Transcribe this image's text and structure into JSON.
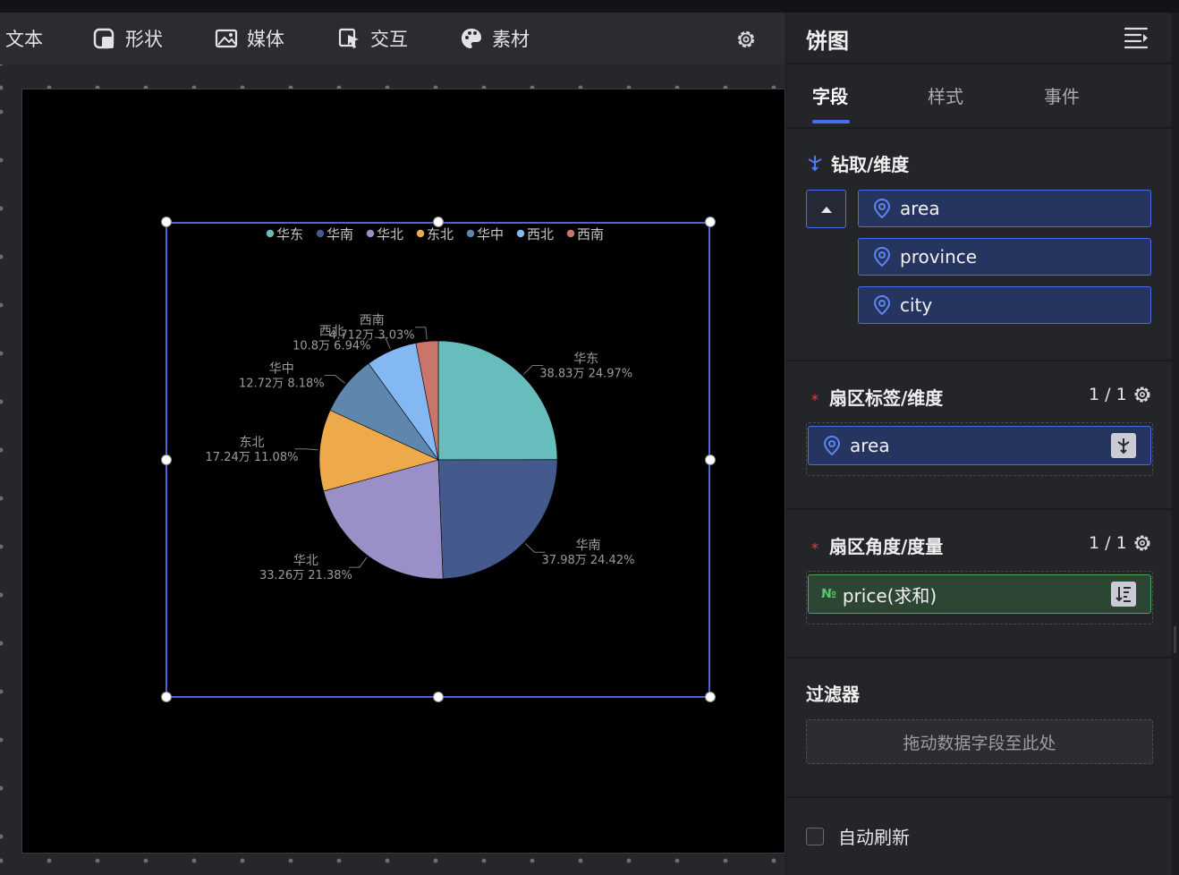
{
  "toolbar": {
    "items": [
      {
        "label": "文本",
        "icon": "text-icon"
      },
      {
        "label": "形状",
        "icon": "shape-icon"
      },
      {
        "label": "媒体",
        "icon": "image-icon"
      },
      {
        "label": "交互",
        "icon": "pointer-icon"
      },
      {
        "label": "素材",
        "icon": "palette-icon"
      }
    ],
    "settings_icon": "gear-icon"
  },
  "panel": {
    "title": "饼图",
    "menu_icon": "menu-collapse-icon",
    "tabs": [
      {
        "label": "字段",
        "active": true
      },
      {
        "label": "样式",
        "active": false
      },
      {
        "label": "事件",
        "active": false
      }
    ],
    "drill": {
      "label": "钻取/维度",
      "fields": [
        "area",
        "province",
        "city"
      ]
    },
    "sector_label": {
      "label": "扇区标签/维度",
      "count": "1 / 1",
      "field": "area"
    },
    "sector_angle": {
      "label": "扇区角度/度量",
      "count": "1 / 1",
      "field": "price(求和)",
      "type_badge": "№"
    },
    "filter": {
      "label": "过滤器",
      "placeholder": "拖动数据字段至此处"
    },
    "auto_refresh": {
      "label": "自动刷新",
      "checked": false
    }
  },
  "chart_data": {
    "type": "pie",
    "categories": [
      "华东",
      "华南",
      "华北",
      "东北",
      "华中",
      "西北",
      "西南"
    ],
    "values": [
      38.83,
      37.98,
      33.26,
      17.24,
      12.72,
      10.8,
      4.712
    ],
    "value_labels": [
      "38.83万",
      "37.98万",
      "33.26万",
      "17.24万",
      "12.72万",
      "10.8万",
      "4.712万"
    ],
    "percent_labels": [
      "24.97%",
      "24.42%",
      "21.38%",
      "11.08%",
      "8.18%",
      "6.94%",
      "3.03%"
    ],
    "colors": [
      "#67bcbc",
      "#455a8c",
      "#9a8fc7",
      "#eeaa4a",
      "#5f87ae",
      "#84b8f2",
      "#c9756a"
    ],
    "legend_position": "top-center",
    "title": ""
  },
  "colors": {
    "accent": "#4a6cf0",
    "panel_bg": "#242529",
    "measure_green": "#48a858"
  }
}
